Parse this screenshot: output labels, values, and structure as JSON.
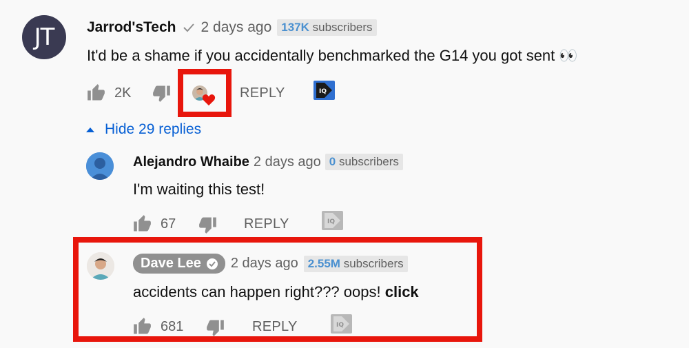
{
  "comments": [
    {
      "avatar_initials": "JT",
      "author": "Jarrod'sTech",
      "time": "2 days ago",
      "subscribers_count": "137K",
      "subscribers_label": "subscribers",
      "text": "It'd be a shame if you accidentally benchmarked the G14 you got sent",
      "emoji": "👀",
      "likes": "2K",
      "reply_label": "REPLY"
    },
    {
      "author": "Alejandro Whaibe",
      "time": "2 days ago",
      "subscribers_count": "0",
      "subscribers_label": "subscribers",
      "text": "I'm waiting this test!",
      "likes": "67",
      "reply_label": "REPLY"
    },
    {
      "author": "Dave Lee",
      "time": "2 days ago",
      "subscribers_count": "2.55M",
      "subscribers_label": "subscribers",
      "text": "accidents can happen right??? oops!",
      "text_bold": "click",
      "likes": "681",
      "reply_label": "REPLY"
    }
  ],
  "hide_replies_label": "Hide 29 replies",
  "colors": {
    "highlight": "#e8160c",
    "link": "#065fd4",
    "subscriber_count": "#4a90d0",
    "creator_badge": "#909090"
  }
}
